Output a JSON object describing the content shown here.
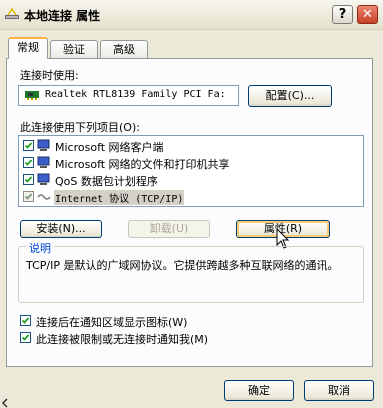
{
  "window": {
    "title": "本地连接 属性",
    "help_label": "?",
    "close_label": "✕"
  },
  "tabs": [
    {
      "label": "常规",
      "active": true
    },
    {
      "label": "验证",
      "active": false
    },
    {
      "label": "高级",
      "active": false
    }
  ],
  "connect_using": {
    "label": "连接时使用:",
    "adapter": "Realtek RTL8139 Family PCI Fa:",
    "configure_button": "配置(C)..."
  },
  "items_section": {
    "label": "此连接使用下列项目(O):",
    "items": [
      {
        "label": "Microsoft 网络客户端",
        "checked": true,
        "icon": "network-client-icon"
      },
      {
        "label": "Microsoft 网络的文件和打印机共享",
        "checked": true,
        "icon": "file-printer-sharing-icon"
      },
      {
        "label": "QoS 数据包计划程序",
        "checked": true,
        "icon": "qos-scheduler-icon"
      },
      {
        "label": "Internet 协议 (TCP/IP)",
        "checked": true,
        "icon": "tcpip-protocol-icon",
        "selected": true
      }
    ]
  },
  "item_buttons": {
    "install": "安装(N)...",
    "uninstall": "卸载(U)",
    "properties": "属性(R)"
  },
  "description": {
    "title": "说明",
    "text": "TCP/IP 是默认的广域网协议。它提供跨越多种互联网络的通讯。"
  },
  "options": [
    {
      "label": "连接后在通知区域显示图标(W)",
      "checked": true
    },
    {
      "label": "此连接被限制或无连接时通知我(M)",
      "checked": true
    }
  ],
  "footer": {
    "ok": "确定",
    "cancel": "取消"
  },
  "colors": {
    "accent_tab": "#f7b13c",
    "group_title": "#0046d5",
    "close_button": "#c64026"
  }
}
